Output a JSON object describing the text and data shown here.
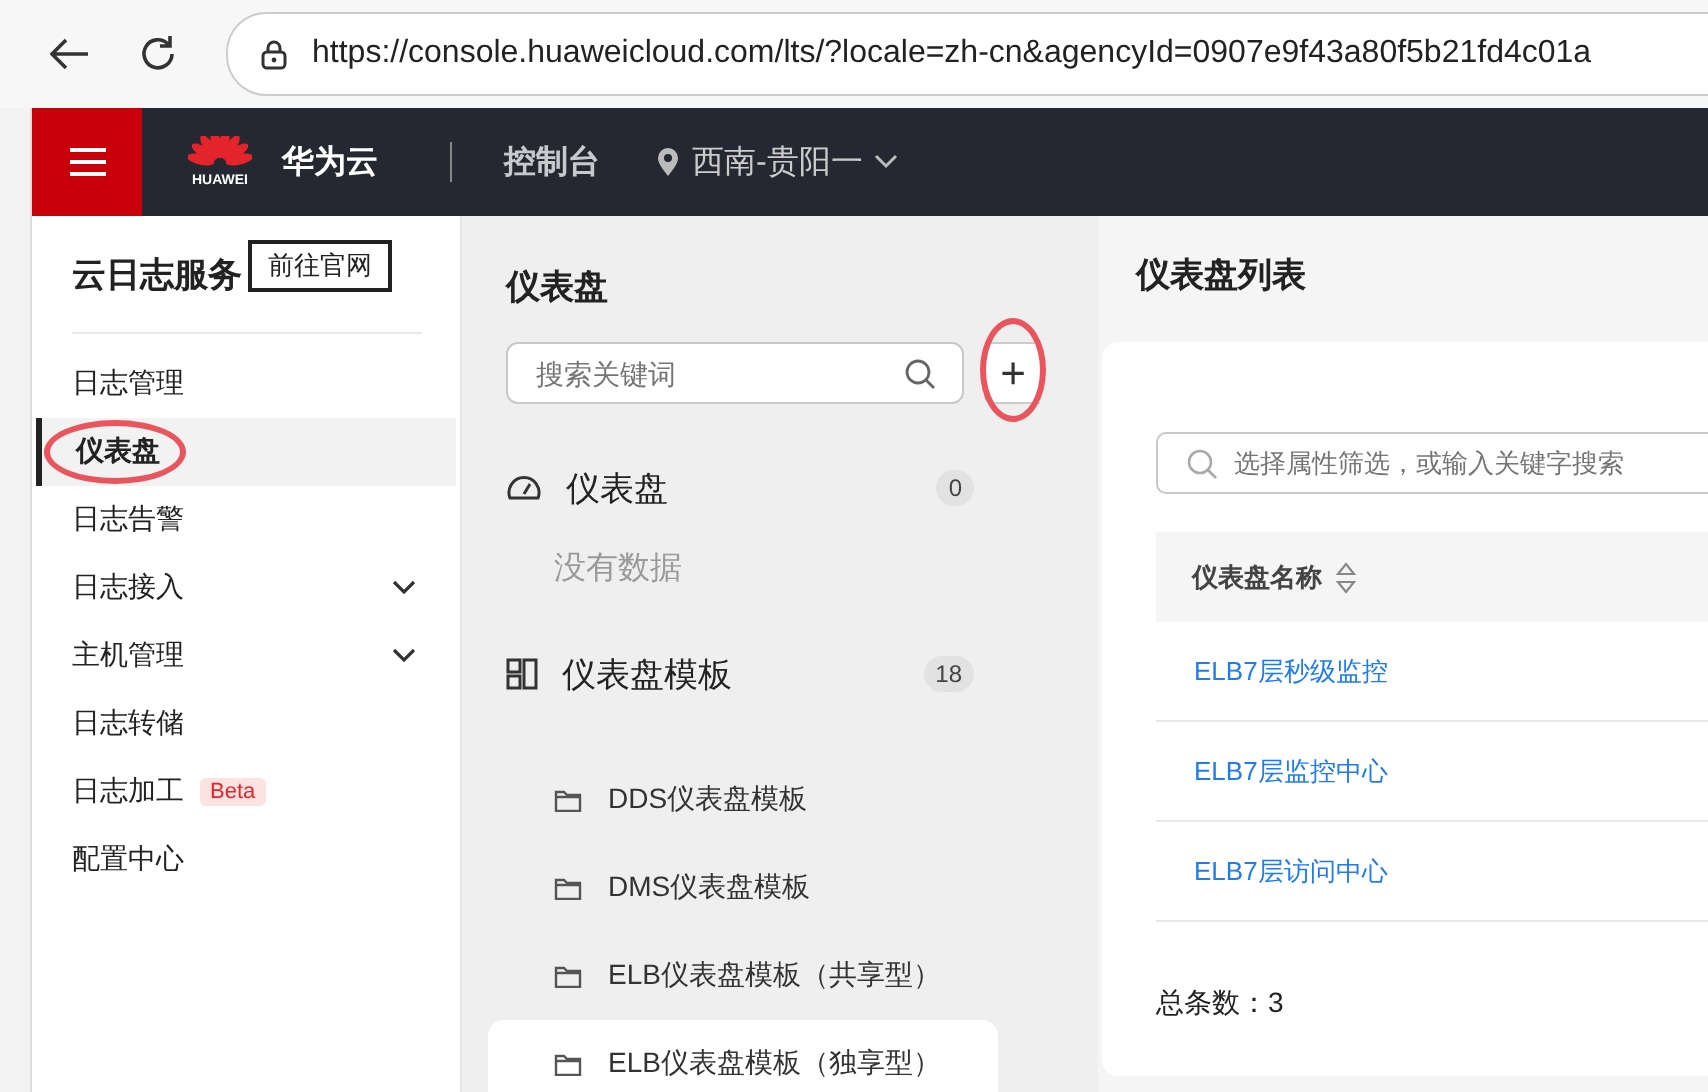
{
  "browser": {
    "url": "https://console.huaweicloud.com/lts/?locale=zh-cn&agencyId=0907e9f43a80f5b21fd4c01a"
  },
  "header": {
    "logo_text": "HUAWEI",
    "brand": "华为云",
    "console": "控制台",
    "region": "西南-贵阳一"
  },
  "sidebar": {
    "title": "云日志服务",
    "tooltip": "前往官网",
    "items": [
      {
        "label": "日志管理",
        "selected": false,
        "expandable": false,
        "circled": false
      },
      {
        "label": "仪表盘",
        "selected": true,
        "expandable": false,
        "circled": true
      },
      {
        "label": "日志告警",
        "selected": false,
        "expandable": false,
        "circled": false
      },
      {
        "label": "日志接入",
        "selected": false,
        "expandable": true,
        "circled": false
      },
      {
        "label": "主机管理",
        "selected": false,
        "expandable": true,
        "circled": false
      },
      {
        "label": "日志转储",
        "selected": false,
        "expandable": false,
        "circled": false
      },
      {
        "label": "日志加工",
        "selected": false,
        "expandable": false,
        "circled": false,
        "badge": "Beta"
      },
      {
        "label": "配置中心",
        "selected": false,
        "expandable": false,
        "circled": false
      }
    ]
  },
  "tree_panel": {
    "title": "仪表盘",
    "search": {
      "placeholder": "搜索关键词"
    },
    "add_button": {
      "label": "+",
      "circled": true
    },
    "groups": [
      {
        "kind": "dashboard",
        "label": "仪表盘",
        "count": "0",
        "empty_text": "没有数据"
      },
      {
        "kind": "template",
        "label": "仪表盘模板",
        "count": "18",
        "children": [
          {
            "label": "DDS仪表盘模板",
            "selected": false
          },
          {
            "label": "DMS仪表盘模板",
            "selected": false
          },
          {
            "label": "ELB仪表盘模板（共享型）",
            "selected": false
          },
          {
            "label": "ELB仪表盘模板（独享型）",
            "selected": true
          }
        ]
      }
    ]
  },
  "list_panel": {
    "title": "仪表盘列表",
    "filter": {
      "placeholder": "选择属性筛选，或输入关键字搜索"
    },
    "table": {
      "columns": [
        {
          "label": "仪表盘名称",
          "sortable": true
        }
      ],
      "rows": [
        {
          "name": "ELB7层秒级监控"
        },
        {
          "name": "ELB7层监控中心"
        },
        {
          "name": "ELB7层访问中心"
        }
      ]
    },
    "total": "总条数：3"
  }
}
